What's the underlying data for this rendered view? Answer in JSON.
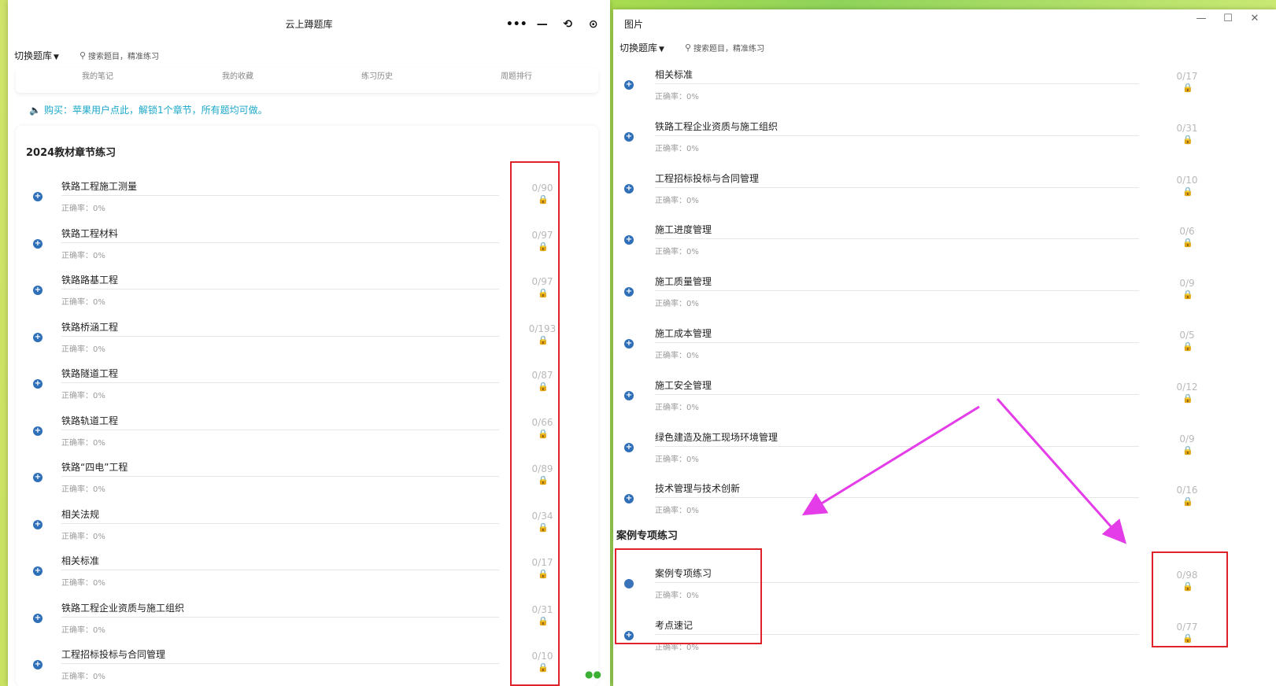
{
  "left_window": {
    "title": "云上蹲题库",
    "capsule": {
      "more": "•••",
      "minimize": "—",
      "restore": "⟲",
      "record": "⊙"
    },
    "toolbar": {
      "switch_label": "切换题库",
      "search_placeholder": "搜索题目，精准练习"
    },
    "quicklinks": [
      "我的笔记",
      "我的收藏",
      "练习历史",
      "周题排行"
    ],
    "notice": "购买：苹果用户点此，解锁1个章节，所有题均可做。",
    "section_title": "2024教材章节练习",
    "accuracy_label": "正确率：0%",
    "chapters": [
      {
        "name": "铁路工程施工测量",
        "count": "0/90"
      },
      {
        "name": "铁路工程材料",
        "count": "0/97"
      },
      {
        "name": "铁路路基工程",
        "count": "0/97"
      },
      {
        "name": "铁路桥涵工程",
        "count": "0/193"
      },
      {
        "name": "铁路隧道工程",
        "count": "0/87"
      },
      {
        "name": "铁路轨道工程",
        "count": "0/66"
      },
      {
        "name": "铁路“四电”工程",
        "count": "0/89"
      },
      {
        "name": "相关法规",
        "count": "0/34"
      },
      {
        "name": "相关标准",
        "count": "0/17"
      },
      {
        "name": "铁路工程企业资质与施工组织",
        "count": "0/31"
      },
      {
        "name": "工程招标投标与合同管理",
        "count": "0/10"
      }
    ]
  },
  "right_window": {
    "title": "图片",
    "controls": {
      "minimize": "—",
      "maximize": "☐",
      "close": "✕"
    },
    "toolbar": {
      "switch_label": "切换题库",
      "search_placeholder": "搜索题目，精准练习"
    },
    "accuracy_label": "正确率：0%",
    "chapters": [
      {
        "name": "相关标准",
        "count": "0/17"
      },
      {
        "name": "铁路工程企业资质与施工组织",
        "count": "0/31"
      },
      {
        "name": "工程招标投标与合同管理",
        "count": "0/10"
      },
      {
        "name": "施工进度管理",
        "count": "0/6"
      },
      {
        "name": "施工质量管理",
        "count": "0/9"
      },
      {
        "name": "施工成本管理",
        "count": "0/5"
      },
      {
        "name": "施工安全管理",
        "count": "0/12"
      },
      {
        "name": "绿色建造及施工现场环境管理",
        "count": "0/9"
      },
      {
        "name": "技术管理与技术创新",
        "count": "0/16"
      }
    ],
    "case_section_title": "案例专项练习",
    "case_items": [
      {
        "name": "案例专项练习",
        "count": "0/98"
      },
      {
        "name": "考点速记",
        "count": "0/77"
      }
    ]
  },
  "colors": {
    "accent": "#2f6fb8",
    "lock": "#f0a11a",
    "notice": "#1aa7c8",
    "highlight_box": "#e0222a",
    "arrow": "#e43ce8"
  },
  "icons": [
    "plus-circle-icon",
    "lock-icon",
    "speaker-icon",
    "search-icon",
    "wechat-icon",
    "caret-down-icon"
  ]
}
